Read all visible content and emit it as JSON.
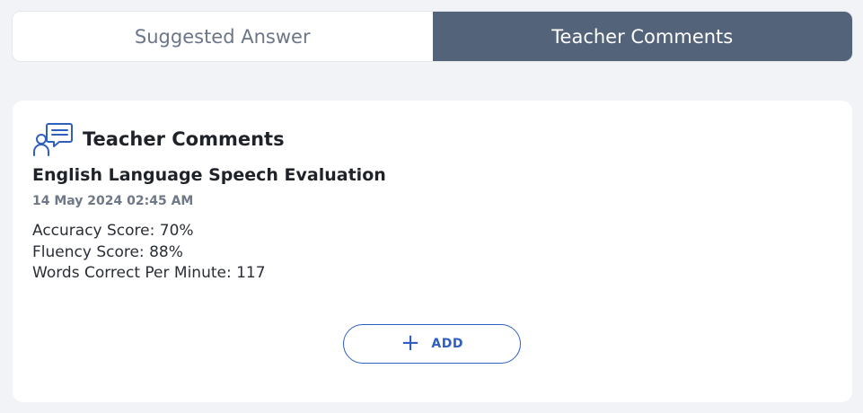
{
  "tabs": [
    {
      "label": "Suggested Answer",
      "active": false
    },
    {
      "label": "Teacher Comments",
      "active": true
    }
  ],
  "card": {
    "icon": "chat-person-icon",
    "title": "Teacher Comments",
    "entry": {
      "title": "English Language Speech Evaluation",
      "date": "14 May 2024 02:45 AM",
      "scores": [
        "Accuracy Score: 70%",
        "Fluency Score: 88%",
        "Words Correct Per Minute: 117"
      ]
    },
    "add_button": {
      "icon": "plus-icon",
      "label": "ADD"
    }
  },
  "colors": {
    "background": "#f2f3f6",
    "active_tab": "#536379",
    "accent": "#2f5fbf"
  }
}
